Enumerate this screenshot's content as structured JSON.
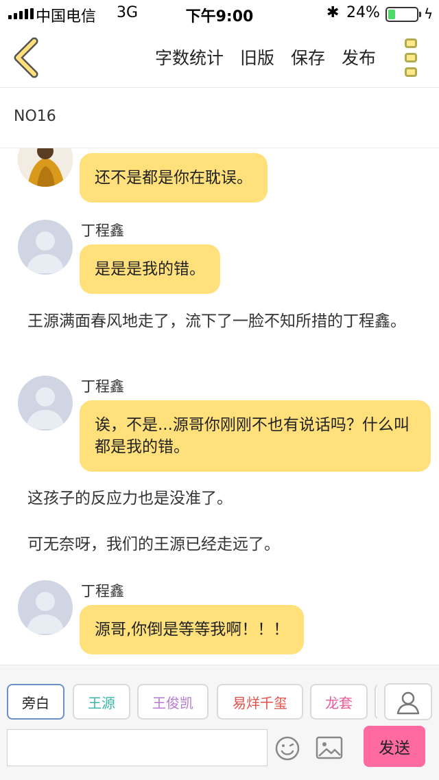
{
  "status_bar": {
    "carrier": "中国电信",
    "network": "3G",
    "time": "下午9:00",
    "bluetooth": "✱",
    "battery_percent": "24%",
    "battery_level": 0.24
  },
  "nav": {
    "actions": [
      "字数统计",
      "旧版",
      "保存",
      "发布"
    ]
  },
  "chapter": {
    "title": "NO16"
  },
  "messages": [
    {
      "type": "dialog",
      "speaker": "",
      "text": "还不是都是你在耽误。"
    },
    {
      "type": "dialog",
      "speaker": "丁程鑫",
      "text": "是是是我的错。"
    },
    {
      "type": "narration",
      "text": "王源满面春风地走了，流下了一脸不知所措的丁程鑫。"
    },
    {
      "type": "dialog",
      "speaker": "丁程鑫",
      "text": "诶，不是...源哥你刚刚不也有说话吗？什么叫都是我的错。"
    },
    {
      "type": "narration",
      "text": "这孩子的反应力也是没准了。"
    },
    {
      "type": "narration",
      "text": "可无奈呀，我们的王源已经走远了。"
    },
    {
      "type": "dialog",
      "speaker": "丁程鑫",
      "text": "源哥,你倒是等等我啊！！！"
    }
  ],
  "roles": [
    {
      "label": "旁白",
      "color": "#222222"
    },
    {
      "label": "王源",
      "color": "#3bb7a8"
    },
    {
      "label": "王俊凯",
      "color": "#b57bd1"
    },
    {
      "label": "易烊千玺",
      "color": "#e0504a"
    },
    {
      "label": "龙套",
      "color": "#e85a9a"
    }
  ],
  "input": {
    "value": "",
    "placeholder": ""
  },
  "send_label": "发送",
  "icons": {
    "back": "back-chevron-icon",
    "more": "more-vertical-icon",
    "user": "user-icon",
    "emoji": "smiley-icon",
    "image": "image-icon"
  }
}
